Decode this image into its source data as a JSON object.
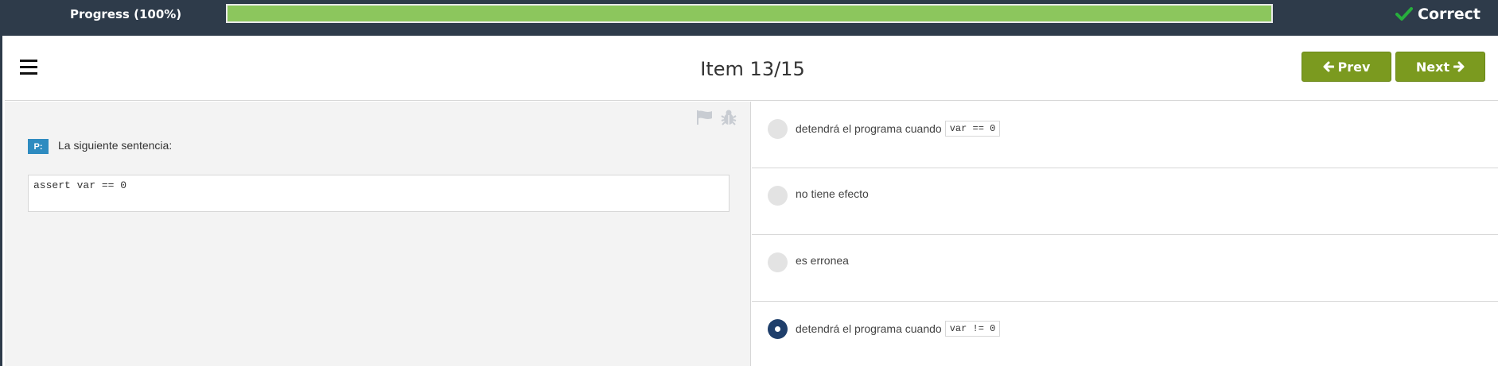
{
  "progress": {
    "label": "Progress (100%)",
    "value": 1.0
  },
  "status": {
    "label": "Correct",
    "icon": "check-icon",
    "color": "#27ae3d"
  },
  "header": {
    "title": "Item 13/15",
    "prev_label": "Prev",
    "next_label": "Next",
    "prev_icon": "arrow-left-icon",
    "next_icon": "arrow-right-icon",
    "menu_icon": "hamburger-menu-icon"
  },
  "question": {
    "badge": "P:",
    "text": "La siguiente sentencia:",
    "code": "assert var == 0",
    "tools": [
      "flag-icon",
      "bug-icon"
    ]
  },
  "options": [
    {
      "text": "detendrá el programa cuando",
      "code": "var == 0",
      "selected": false
    },
    {
      "text": "no tiene efecto",
      "code": "",
      "selected": false
    },
    {
      "text": "es erronea",
      "code": "",
      "selected": false
    },
    {
      "text": "detendrá el programa cuando",
      "code": "var != 0",
      "selected": true
    }
  ],
  "colors": {
    "topbar": "#2e3b4a",
    "progress_fill": "#8cc65d",
    "nav_button": "#7b9a1f",
    "badge": "#2e8bc0",
    "selected_radio": "#1f3f6b"
  }
}
